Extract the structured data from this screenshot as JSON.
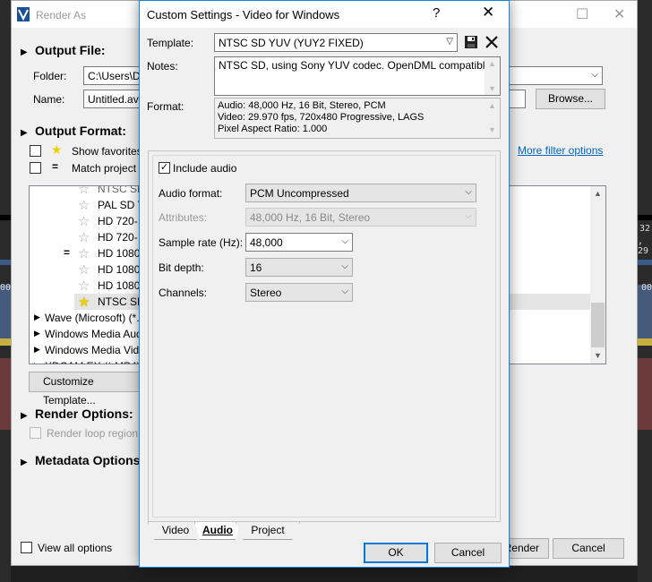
{
  "render_as": {
    "title": "Render As",
    "output_file": {
      "heading": "Output File:",
      "folder_label": "Folder:",
      "folder_value": "C:\\Users\\D",
      "name_label": "Name:",
      "name_value": "Untitled.avi",
      "browse": "Browse..."
    },
    "output_format": {
      "heading": "Output Format:",
      "show_favorites": "Show favorites",
      "match_project": "Match project",
      "more_filter": "More filter options",
      "tree": [
        {
          "label": "NTSC SD",
          "indent": 2,
          "star": "gray",
          "partial": true
        },
        {
          "label": "PAL SD Y",
          "indent": 2,
          "star": "gray"
        },
        {
          "label": "HD 720-",
          "indent": 2,
          "star": "gray"
        },
        {
          "label": "HD 720-",
          "indent": 2,
          "star": "gray"
        },
        {
          "label": "HD 1080",
          "indent": 2,
          "star": "gray",
          "eq": true
        },
        {
          "label": "HD 1080",
          "indent": 2,
          "star": "gray"
        },
        {
          "label": "HD 1080",
          "indent": 2,
          "star": "gray"
        },
        {
          "label": "NTSC SD",
          "indent": 2,
          "star": "gold",
          "selected": true
        },
        {
          "label": "Wave (Microsoft) (*.wav)",
          "indent": 1,
          "expander": true
        },
        {
          "label": "Windows Media Audio",
          "indent": 1,
          "expander": true
        },
        {
          "label": "Windows Media Video",
          "indent": 1,
          "expander": true
        },
        {
          "label": "XDCAM EX (*.MP4)",
          "indent": 1,
          "expander": true
        }
      ],
      "customize": "Customize Template..."
    },
    "render_options": {
      "heading": "Render Options:",
      "loop_region": "Render loop region only"
    },
    "metadata_options": {
      "heading": "Metadata Options:"
    },
    "view_all": "View all options",
    "render_btn": "Render",
    "cancel_btn": "Cancel"
  },
  "dialog": {
    "title": "Custom Settings - Video for Windows",
    "help_glyph": "?",
    "close_glyph": "✕",
    "template_label": "Template:",
    "template_value": "NTSC SD YUV (YUY2 FIXED)",
    "notes_label": "Notes:",
    "notes_value": "NTSC SD, using Sony YUV codec. OpenDML compatible.",
    "format_label": "Format:",
    "format_lines": [
      "Audio: 48,000 Hz, 16 Bit, Stereo, PCM",
      "Video: 29.970 fps, 720x480 Progressive, LAGS",
      "Pixel Aspect Ratio: 1.000"
    ],
    "include_audio": "Include audio",
    "audio_format_label": "Audio format:",
    "audio_format_value": "PCM Uncompressed",
    "attributes_label": "Attributes:",
    "attributes_value": "48,000 Hz, 16 Bit, Stereo",
    "sample_rate_label": "Sample rate (Hz):",
    "sample_rate_value": "48,000",
    "bit_depth_label": "Bit depth:",
    "bit_depth_value": "16",
    "channels_label": "Channels:",
    "channels_value": "Stereo",
    "tabs": [
      "Video",
      "Audio",
      "Project"
    ],
    "active_tab": "Audio",
    "ok": "OK",
    "cancel": "Cancel"
  },
  "background": {
    "ruler_a": "32,",
    "ruler_b": ", 29",
    "ruler_c": "00",
    "ruler_d": "00"
  }
}
